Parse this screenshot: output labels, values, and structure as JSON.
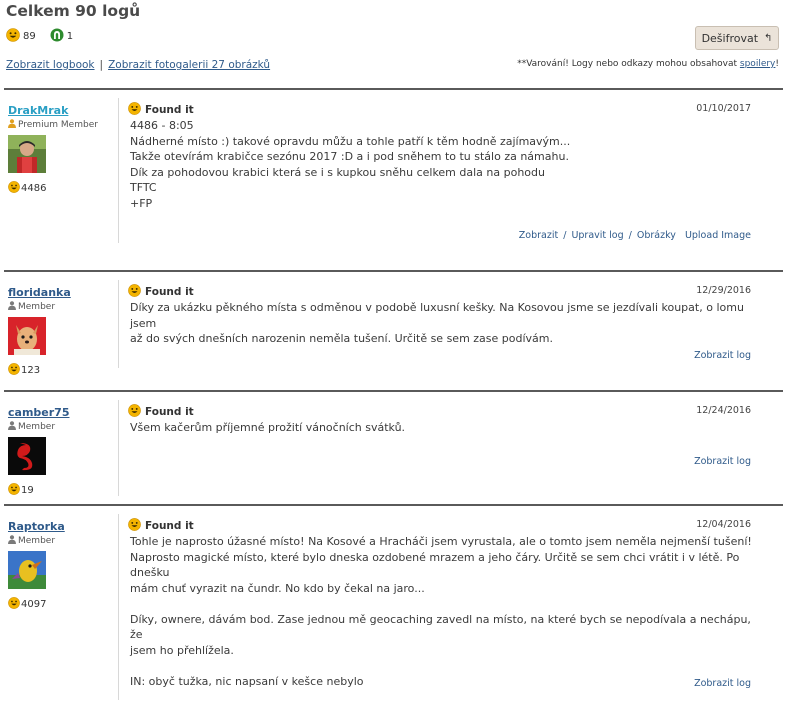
{
  "header": {
    "title": "Celkem 90 logů",
    "found_count": "89",
    "attended_count": "1",
    "decode_label": "Dešifrovat",
    "link_logbook": "Zobrazit logbook",
    "link_separator": "|",
    "link_gallery": "Zobrazit fotogalerii 27 obrázků",
    "warning_prefix": "**Varování! Logy nebo odkazy mohou obsahovat ",
    "warning_link": "spoilery",
    "warning_suffix": "!"
  },
  "logs": [
    {
      "username": "DrakMrak",
      "username_color": "#2a9fc4",
      "role": "Premium Member",
      "finds": "4486",
      "type": "Found it",
      "date": "01/10/2017",
      "lines": [
        "4486 - 8:05",
        "Nádherné místo :) takové opravdu můžu a tohle patří k těm hodně zajímavým...",
        "Takže otevírám krabičce sezónu 2017 :D a i pod sněhem to tu stálo za námahu.",
        "Dík za pohodovou krabici která se i s kupkou sněhu celkem dala na pohodu",
        "TFTC",
        "+FP"
      ],
      "actions": [
        "Zobrazit",
        "Upravit log",
        "Obrázky",
        "Upload Image"
      ]
    },
    {
      "username": "floridanka",
      "username_color": "#2f5a8a",
      "role": "Member",
      "finds": "123",
      "type": "Found it",
      "date": "12/29/2016",
      "lines": [
        "Díky za ukázku pěkného místa s odměnou v podobě luxusní kešky. Na Kosovou jsme se jezdívali koupat, o lomu jsem",
        "až do svých dnešních narozenin neměla tušení. Určitě se sem zase podívám."
      ],
      "actions": [
        "Zobrazit log"
      ]
    },
    {
      "username": "camber75",
      "username_color": "#2f5a8a",
      "role": "Member",
      "finds": "19",
      "type": "Found it",
      "date": "12/24/2016",
      "lines": [
        "Všem kačerům příjemné prožití vánočních svátků."
      ],
      "actions": [
        "Zobrazit log"
      ]
    },
    {
      "username": "Raptorka",
      "username_color": "#2f5a8a",
      "role": "Member",
      "finds": "4097",
      "type": "Found it",
      "date": "12/04/2016",
      "lines": [
        "Tohle je naprosto úžasné místo! Na Kosové a Hracháči jsem vyrustala, ale o tomto jsem neměla nejmenší tušení!",
        "Naprosto magické místo, které bylo dneska ozdobené mrazem a jeho čáry. Určitě se sem chci vrátit i v létě. Po dnešku",
        "mám chuť vyrazit na čundr. No kdo by čekal na jaro...",
        "",
        "Díky, ownere, dávám bod. Zase jednou mě geocaching zavedl na místo, na které bych se nepodívala a nechápu, že",
        "jsem ho přehlížela.",
        "",
        "IN: obyč tužka, nic napsaní v kešce nebylo"
      ],
      "actions": [
        "Zobrazit log"
      ]
    }
  ]
}
